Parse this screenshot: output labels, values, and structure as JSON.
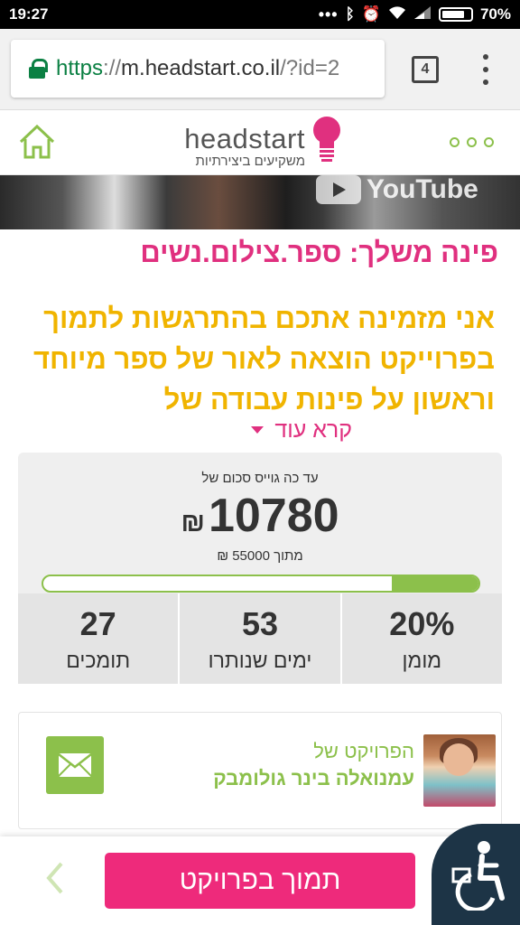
{
  "status_bar": {
    "time": "19:27",
    "icons": [
      "more-dots-icon",
      "bluetooth-icon",
      "alarm-icon",
      "wifi-icon",
      "signal-icon",
      "battery-icon"
    ],
    "battery": "70%"
  },
  "browser": {
    "url_scheme": "https",
    "url_sep": "://",
    "url_host": "m.headstart.co.il",
    "url_path": "/?id=2",
    "tab_count": "4"
  },
  "site_header": {
    "logo_word": "headstart",
    "logo_tagline": "משקיעים ביצירתיות",
    "brand_color_pink": "#e0307f",
    "brand_color_green": "#8cc04b"
  },
  "video": {
    "watermark": "YouTube"
  },
  "project": {
    "title": "פינה משלך: ספר.צילום.נשים",
    "description": "אני מזמינה אתכם בהתרגשות לתמוך בפרוייקט הוצאה לאור של ספר מיוחד וראשון על פינות עבודה של",
    "read_more": "קרא עוד"
  },
  "funding": {
    "raised_label": "עד כה גוייס סכום של",
    "amount": "10780",
    "currency": "₪",
    "goal_text": "מתוך 55000 ₪",
    "progress_fraction": 0.2,
    "stats": [
      {
        "value": "20%",
        "label": "מומן"
      },
      {
        "value": "53",
        "label": "ימים שנותרו"
      },
      {
        "value": "27",
        "label": "תומכים"
      }
    ]
  },
  "owner": {
    "prefix": "הפרויקט של",
    "name": "עמנואלה בינר גולומבק"
  },
  "bottom_bar": {
    "support_label": "תמוך בפרויקט"
  }
}
